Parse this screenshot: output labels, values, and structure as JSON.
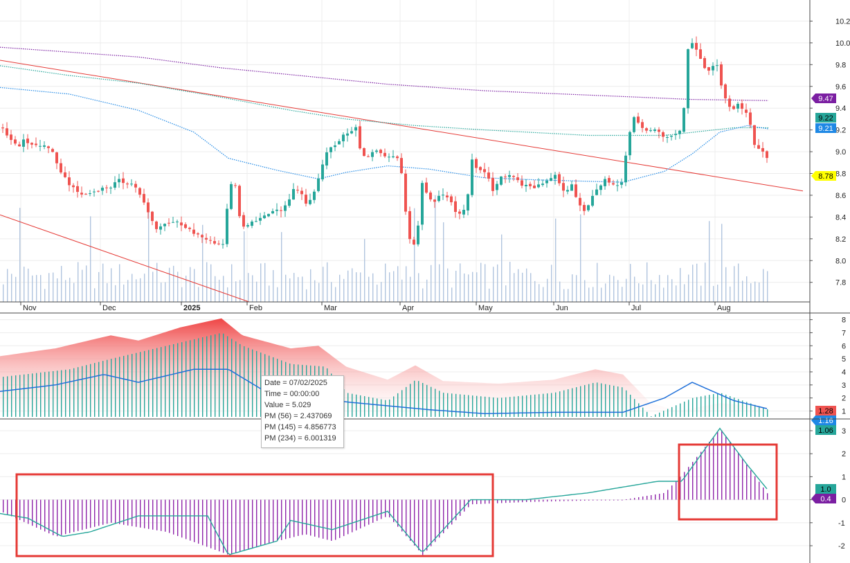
{
  "chart_data": [
    {
      "type": "candlestick",
      "name": "price",
      "ylim": [
        7.62,
        10.33
      ],
      "y_ticks": [
        "10.2",
        "10.0",
        "9.8",
        "9.6",
        "9.4",
        "9.2",
        "9.0",
        "8.8",
        "8.6",
        "8.4",
        "8.2",
        "8.0",
        "7.8"
      ],
      "x_ticks": [
        "Nov",
        "Dec",
        "2025",
        "Feb",
        "Mar",
        "Apr",
        "May",
        "Jun",
        "Jul",
        "Aug"
      ],
      "price_path": [
        [
          0,
          9.22
        ],
        [
          8,
          9.15
        ],
        [
          16,
          9.1
        ],
        [
          24,
          9.05
        ],
        [
          32,
          9.1
        ],
        [
          40,
          9.08
        ],
        [
          48,
          9.06
        ],
        [
          56,
          9.05
        ],
        [
          64,
          9.06
        ],
        [
          72,
          9.02
        ],
        [
          80,
          8.88
        ],
        [
          88,
          8.8
        ],
        [
          96,
          8.72
        ],
        [
          104,
          8.66
        ],
        [
          112,
          8.62
        ],
        [
          120,
          8.6
        ],
        [
          128,
          8.62
        ],
        [
          136,
          8.64
        ],
        [
          144,
          8.66
        ],
        [
          152,
          8.67
        ],
        [
          160,
          8.68
        ],
        [
          168,
          8.74
        ],
        [
          176,
          8.72
        ],
        [
          184,
          8.71
        ],
        [
          192,
          8.7
        ],
        [
          200,
          8.6
        ],
        [
          208,
          8.5
        ],
        [
          216,
          8.38
        ],
        [
          224,
          8.3
        ],
        [
          232,
          8.32
        ],
        [
          240,
          8.35
        ],
        [
          248,
          8.36
        ],
        [
          256,
          8.34
        ],
        [
          264,
          8.3
        ],
        [
          272,
          8.28
        ],
        [
          280,
          8.24
        ],
        [
          288,
          8.22
        ],
        [
          296,
          8.2
        ],
        [
          304,
          8.18
        ],
        [
          312,
          8.16
        ],
        [
          320,
          8.14
        ],
        [
          328,
          8.6
        ],
        [
          336,
          8.78
        ],
        [
          344,
          8.4
        ],
        [
          352,
          8.3
        ],
        [
          360,
          8.34
        ],
        [
          368,
          8.36
        ],
        [
          376,
          8.4
        ],
        [
          384,
          8.42
        ],
        [
          392,
          8.44
        ],
        [
          400,
          8.46
        ],
        [
          408,
          8.48
        ],
        [
          416,
          8.55
        ],
        [
          424,
          8.7
        ],
        [
          432,
          8.62
        ],
        [
          440,
          8.52
        ],
        [
          448,
          8.56
        ],
        [
          456,
          8.7
        ],
        [
          464,
          8.88
        ],
        [
          472,
          9.04
        ],
        [
          480,
          9.06
        ],
        [
          488,
          9.1
        ],
        [
          496,
          9.16
        ],
        [
          504,
          9.18
        ],
        [
          512,
          9.24
        ],
        [
          520,
          8.98
        ],
        [
          528,
          8.94
        ],
        [
          536,
          9.0
        ],
        [
          544,
          9.02
        ],
        [
          552,
          8.98
        ],
        [
          560,
          8.94
        ],
        [
          568,
          8.98
        ],
        [
          576,
          8.92
        ],
        [
          584,
          8.45
        ],
        [
          592,
          8.12
        ],
        [
          600,
          8.2
        ],
        [
          608,
          8.7
        ],
        [
          616,
          8.6
        ],
        [
          624,
          8.54
        ],
        [
          632,
          8.58
        ],
        [
          640,
          8.62
        ],
        [
          648,
          8.56
        ],
        [
          656,
          8.46
        ],
        [
          664,
          8.42
        ],
        [
          672,
          8.52
        ],
        [
          680,
          8.92
        ],
        [
          688,
          8.84
        ],
        [
          696,
          8.82
        ],
        [
          704,
          8.74
        ],
        [
          712,
          8.62
        ],
        [
          720,
          8.76
        ],
        [
          728,
          8.78
        ],
        [
          736,
          8.8
        ],
        [
          744,
          8.74
        ],
        [
          752,
          8.7
        ],
        [
          760,
          8.68
        ],
        [
          768,
          8.66
        ],
        [
          776,
          8.7
        ],
        [
          784,
          8.72
        ],
        [
          792,
          8.76
        ],
        [
          800,
          8.78
        ],
        [
          808,
          8.68
        ],
        [
          816,
          8.62
        ],
        [
          824,
          8.7
        ],
        [
          832,
          8.54
        ],
        [
          840,
          8.46
        ],
        [
          848,
          8.5
        ],
        [
          856,
          8.62
        ],
        [
          864,
          8.66
        ],
        [
          872,
          8.74
        ],
        [
          880,
          8.7
        ],
        [
          888,
          8.68
        ],
        [
          896,
          8.72
        ],
        [
          904,
          9.04
        ],
        [
          912,
          9.32
        ],
        [
          920,
          9.26
        ],
        [
          928,
          9.22
        ],
        [
          936,
          9.18
        ],
        [
          944,
          9.2
        ],
        [
          952,
          9.16
        ],
        [
          960,
          9.14
        ],
        [
          968,
          9.16
        ],
        [
          976,
          9.18
        ],
        [
          984,
          9.22
        ],
        [
          992,
          9.94
        ],
        [
          1000,
          10.02
        ],
        [
          1008,
          9.86
        ],
        [
          1016,
          9.78
        ],
        [
          1024,
          9.72
        ],
        [
          1032,
          9.84
        ],
        [
          1040,
          9.6
        ],
        [
          1048,
          9.44
        ],
        [
          1056,
          9.38
        ],
        [
          1064,
          9.44
        ],
        [
          1072,
          9.38
        ],
        [
          1080,
          9.32
        ],
        [
          1088,
          9.06
        ],
        [
          1096,
          9.02
        ],
        [
          1104,
          9.0
        ],
        [
          1110,
          8.8
        ]
      ],
      "overlays": {
        "trendline_upper": [
          [
            0,
            9.84
          ],
          [
            1160,
            8.64
          ]
        ],
        "trendline_lower": [
          [
            0,
            8.42
          ],
          [
            360,
            7.62
          ]
        ],
        "ma_long_purple": [
          [
            0,
            9.96
          ],
          [
            200,
            9.87
          ],
          [
            320,
            9.77
          ],
          [
            400,
            9.72
          ],
          [
            560,
            9.62
          ],
          [
            700,
            9.56
          ],
          [
            850,
            9.52
          ],
          [
            1000,
            9.48
          ],
          [
            1110,
            9.47
          ]
        ],
        "ma_mid_teal": [
          [
            0,
            9.79
          ],
          [
            100,
            9.7
          ],
          [
            200,
            9.63
          ],
          [
            320,
            9.5
          ],
          [
            420,
            9.38
          ],
          [
            500,
            9.3
          ],
          [
            600,
            9.24
          ],
          [
            700,
            9.2
          ],
          [
            850,
            9.15
          ],
          [
            960,
            9.15
          ],
          [
            1060,
            9.22
          ],
          [
            1110,
            9.22
          ]
        ],
        "ma_short_blue": [
          [
            0,
            9.59
          ],
          [
            100,
            9.53
          ],
          [
            200,
            9.38
          ],
          [
            280,
            9.18
          ],
          [
            330,
            8.94
          ],
          [
            400,
            8.83
          ],
          [
            460,
            8.75
          ],
          [
            500,
            8.81
          ],
          [
            560,
            8.87
          ],
          [
            620,
            8.84
          ],
          [
            700,
            8.76
          ],
          [
            780,
            8.74
          ],
          [
            840,
            8.73
          ],
          [
            900,
            8.72
          ],
          [
            960,
            8.82
          ],
          [
            1000,
            8.98
          ],
          [
            1040,
            9.18
          ],
          [
            1080,
            9.24
          ],
          [
            1110,
            9.21
          ]
        ]
      },
      "labels": {
        "purple": "9.47",
        "teal": "9.22",
        "blue": "9.21",
        "price": "8.78"
      },
      "colors": {
        "up": "#26a69a",
        "down": "#ef5350",
        "purple": "#7b1fa2",
        "teal": "#26a69a",
        "blue": "#1e88e5",
        "trend": "#e53935",
        "price_tag": "#ffff00",
        "volume": "#b0c4de"
      }
    },
    {
      "type": "area+line+bar",
      "name": "indicator_1",
      "ylim": [
        0.55,
        8.35
      ],
      "y_ticks": [
        "8",
        "7",
        "6",
        "5",
        "4",
        "3",
        "2",
        "1"
      ],
      "red_area": [
        [
          0,
          5.2
        ],
        [
          80,
          5.8
        ],
        [
          160,
          6.8
        ],
        [
          200,
          6.4
        ],
        [
          260,
          7.4
        ],
        [
          320,
          8.1
        ],
        [
          350,
          6.8
        ],
        [
          420,
          5.8
        ],
        [
          460,
          6.0
        ],
        [
          500,
          4.4
        ],
        [
          560,
          3.4
        ],
        [
          600,
          4.5
        ],
        [
          640,
          3.3
        ],
        [
          720,
          3.1
        ],
        [
          800,
          3.4
        ],
        [
          860,
          4.2
        ],
        [
          900,
          3.8
        ],
        [
          940,
          1.6
        ],
        [
          980,
          1.0
        ],
        [
          1040,
          1.6
        ],
        [
          1110,
          1.3
        ]
      ],
      "bar_values": [
        [
          0,
          3.6
        ],
        [
          100,
          4.2
        ],
        [
          160,
          5.0
        ],
        [
          240,
          6.0
        ],
        [
          320,
          7.0
        ],
        [
          350,
          6.0
        ],
        [
          420,
          4.6
        ],
        [
          470,
          4.4
        ],
        [
          500,
          2.4
        ],
        [
          560,
          1.8
        ],
        [
          600,
          3.4
        ],
        [
          640,
          2.4
        ],
        [
          720,
          2.0
        ],
        [
          800,
          2.4
        ],
        [
          860,
          3.2
        ],
        [
          900,
          2.8
        ],
        [
          940,
          0.6
        ],
        [
          1000,
          2.0
        ],
        [
          1040,
          2.4
        ],
        [
          1110,
          1.1
        ]
      ],
      "blue_line": [
        [
          0,
          2.5
        ],
        [
          80,
          3.0
        ],
        [
          150,
          3.8
        ],
        [
          200,
          3.2
        ],
        [
          280,
          4.2
        ],
        [
          330,
          4.2
        ],
        [
          380,
          2.6
        ],
        [
          440,
          2.0
        ],
        [
          520,
          1.6
        ],
        [
          620,
          1.1
        ],
        [
          700,
          0.8
        ],
        [
          800,
          0.9
        ],
        [
          900,
          0.9
        ],
        [
          960,
          2.0
        ],
        [
          1000,
          3.2
        ],
        [
          1060,
          1.8
        ],
        [
          1110,
          1.16
        ]
      ],
      "labels": {
        "red": "1.28",
        "blue": "1.16",
        "teal": "1.06"
      }
    },
    {
      "type": "histogram+line",
      "name": "indicator_2",
      "ylim": [
        -2.45,
        3.3
      ],
      "y_ticks": [
        "3",
        "2",
        "1",
        "0",
        "-1",
        "-2"
      ],
      "histogram": [
        [
          0,
          -0.5
        ],
        [
          80,
          -1.6
        ],
        [
          160,
          -1.0
        ],
        [
          240,
          -1.4
        ],
        [
          330,
          -2.4
        ],
        [
          400,
          -1.8
        ],
        [
          440,
          -1.5
        ],
        [
          480,
          -1.8
        ],
        [
          560,
          -0.7
        ],
        [
          610,
          -2.4
        ],
        [
          680,
          -0.2
        ],
        [
          760,
          -0.1
        ],
        [
          900,
          0.0
        ],
        [
          960,
          0.3
        ],
        [
          985,
          1.1
        ],
        [
          1040,
          3.1
        ],
        [
          1110,
          0.2
        ]
      ],
      "line": [
        [
          0,
          -0.6
        ],
        [
          40,
          -0.8
        ],
        [
          90,
          -1.6
        ],
        [
          130,
          -1.4
        ],
        [
          200,
          -0.7
        ],
        [
          300,
          -0.7
        ],
        [
          330,
          -2.4
        ],
        [
          400,
          -1.8
        ],
        [
          420,
          -0.9
        ],
        [
          480,
          -1.3
        ],
        [
          560,
          -0.5
        ],
        [
          610,
          -2.3
        ],
        [
          680,
          0.0
        ],
        [
          760,
          0.0
        ],
        [
          850,
          0.3
        ],
        [
          950,
          0.8
        ],
        [
          985,
          0.8
        ],
        [
          1040,
          3.1
        ],
        [
          1080,
          1.5
        ],
        [
          1110,
          0.4
        ]
      ],
      "labels": {
        "teal": "1.0",
        "purple": "0.4"
      }
    }
  ],
  "tooltip": {
    "date": "Date = 07/02/2025",
    "time": "Time = 00:00:00",
    "value": "Value = 5.029",
    "pm56": "PM (56) = 2.437069",
    "pm145": "PM (145) = 4.856773",
    "pm234": "PM (234) = 6.001319"
  }
}
